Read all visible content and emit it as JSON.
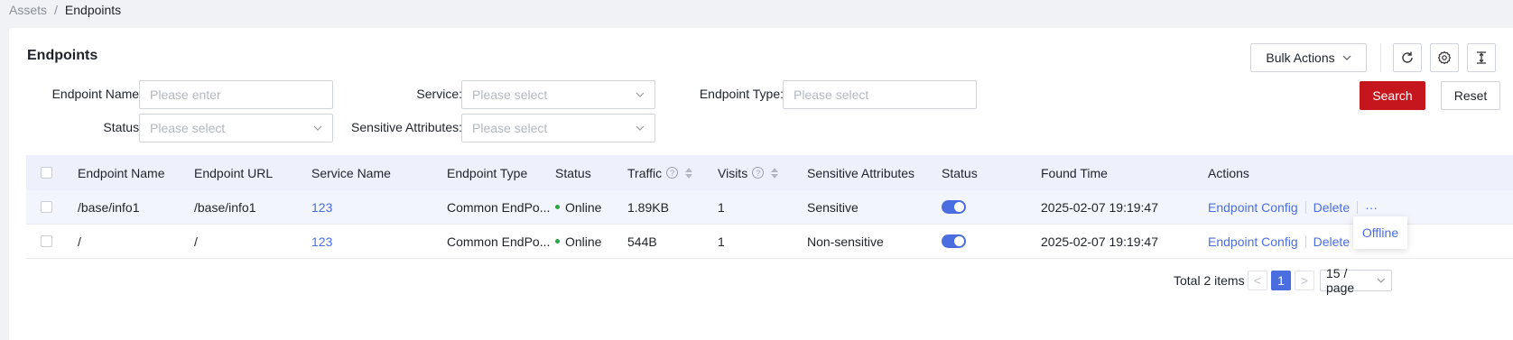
{
  "breadcrumb": {
    "parent": "Assets",
    "separator": "/",
    "current": "Endpoints"
  },
  "page": {
    "title": "Endpoints"
  },
  "toolbar": {
    "bulk_actions": "Bulk Actions",
    "refresh_icon": "refresh-icon",
    "settings_icon": "gear-icon",
    "density_icon": "row-height-icon"
  },
  "filters": {
    "endpoint_name": {
      "label": "Endpoint Name",
      "placeholder": "Please enter"
    },
    "service": {
      "label": "Service",
      "placeholder": "Please select"
    },
    "endpoint_type": {
      "label": "Endpoint Type",
      "placeholder": "Please select"
    },
    "status": {
      "label": "Status",
      "placeholder": "Please select"
    },
    "sensitive_attributes": {
      "label": "Sensitive Attributes",
      "placeholder": "Please select"
    },
    "search_label": "Search",
    "reset_label": "Reset"
  },
  "table": {
    "columns": [
      "Endpoint Name",
      "Endpoint URL",
      "Service Name",
      "Endpoint Type",
      "Status",
      "Traffic",
      "Visits",
      "Sensitive Attributes",
      "Status",
      "Found Time",
      "Actions"
    ],
    "rows": [
      {
        "name": "/base/info1",
        "url": "/base/info1",
        "service": "123",
        "type": "Common EndPo...",
        "status": "Online",
        "traffic": "1.89KB",
        "visits": "1",
        "sensitive": "Sensitive",
        "enabled": true,
        "found_time": "2025-02-07 19:19:47",
        "action_config": "Endpoint Config",
        "action_delete": "Delete",
        "action_more": "···"
      },
      {
        "name": "/",
        "url": "/",
        "service": "123",
        "type": "Common EndPo...",
        "status": "Online",
        "traffic": "544B",
        "visits": "1",
        "sensitive": "Non-sensitive",
        "enabled": true,
        "found_time": "2025-02-07 19:19:47",
        "action_config": "Endpoint Config",
        "action_delete": "Delete"
      }
    ]
  },
  "more_menu": {
    "offline": "Offline"
  },
  "pagination": {
    "total": "Total 2 items",
    "current_page": "1",
    "page_size": "15 / page",
    "prev": "<",
    "next": ">"
  },
  "colors": {
    "primary": "#4a6ee0",
    "danger": "#c4161c",
    "online": "#28a745"
  }
}
